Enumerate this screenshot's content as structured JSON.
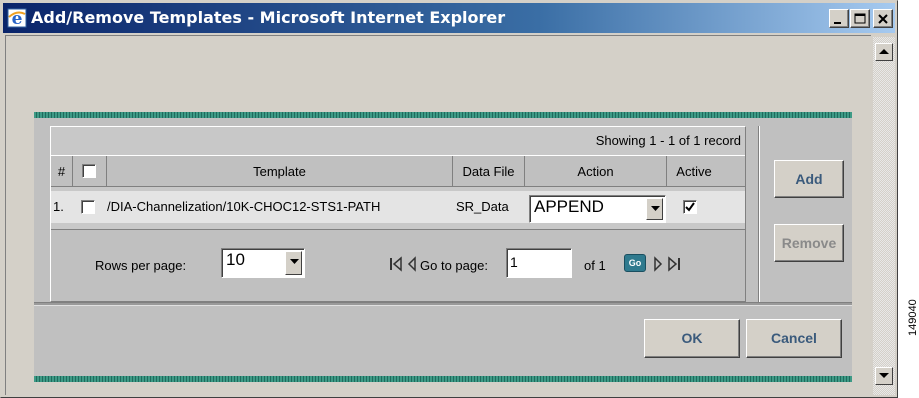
{
  "window": {
    "title": "Add/Remove Templates - Microsoft Internet Explorer"
  },
  "table": {
    "showing": "Showing 1 - 1 of 1 record",
    "headers": {
      "number": "#",
      "template": "Template",
      "data_file": "Data File",
      "action": "Action",
      "active": "Active"
    },
    "rows": [
      {
        "index": "1.",
        "selected": false,
        "template": "/DIA-Channelization/10K-CHOC12-STS1-PATH",
        "data_file": "SR_Data",
        "action": "APPEND",
        "active": true
      }
    ]
  },
  "pager": {
    "rows_per_page_label": "Rows per page:",
    "rows_per_page_value": "10",
    "go_to_page_label": "Go to page:",
    "page_value": "1",
    "of_label": "of 1",
    "go_button": "Go"
  },
  "side_buttons": {
    "add": "Add",
    "remove": "Remove"
  },
  "footer": {
    "ok": "OK",
    "cancel": "Cancel"
  },
  "margin_code": "149040",
  "colors": {
    "titlebar_start": "#0a246a",
    "titlebar_end": "#a6caf0",
    "band": "#2f8a76",
    "go_button": "#2f7a8e"
  }
}
